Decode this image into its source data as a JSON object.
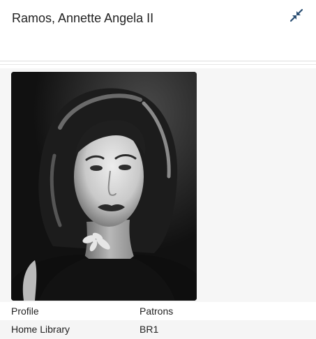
{
  "header": {
    "title": "Ramos, Annette Angela II",
    "collapse_icon": "collapse-arrows-icon"
  },
  "photo": {
    "description_icon": "patron-photo"
  },
  "details": [
    {
      "label": "Profile",
      "value": "Patrons"
    },
    {
      "label": "Home Library",
      "value": "BR1"
    }
  ],
  "colors": {
    "accent": "#2b4f73",
    "header_border": "#dddddd",
    "content_bg": "#f6f6f6"
  }
}
